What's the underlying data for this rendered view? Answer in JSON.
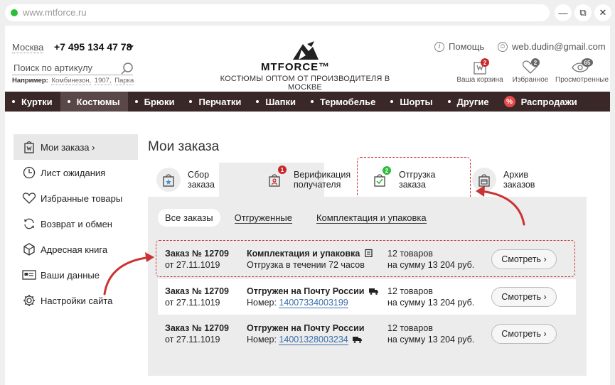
{
  "browser": {
    "url": "www.mtforce.ru",
    "buttons": {
      "minimize": "—",
      "restore": "⧉",
      "close": "✕"
    }
  },
  "header": {
    "city": "Москва",
    "phone": "+7 495 134 47 78",
    "search_placeholder": "Поиск по артикулу",
    "example_label": "Например:",
    "example_items": [
      "Комбинезон,",
      "1907,",
      "Парка"
    ],
    "logo_text": "MTFORCE™",
    "tagline": "КОСТЮМЫ ОПТОМ ОТ ПРОИЗВОДИТЕЛЯ В МОСКВЕ",
    "help": "Помощь",
    "user_email": "web.dudin@gmail.com",
    "cart": {
      "label": "Ваша корзина",
      "count": "2"
    },
    "favorites": {
      "label": "Избранное",
      "count": "2"
    },
    "viewed": {
      "label": "Просмотренные",
      "count": "65"
    }
  },
  "nav": {
    "items": [
      "Куртки",
      "Костюмы",
      "Брюки",
      "Перчатки",
      "Шапки",
      "Термобелье",
      "Шорты",
      "Другие"
    ],
    "sale": "Распродажи"
  },
  "sidebar": {
    "items": [
      "Мои заказа ›",
      "Лист ожидания",
      "Избранные товары",
      "Возврат и обмен",
      "Адресная книга",
      "Ваши данные",
      "Настройки сайта"
    ]
  },
  "main": {
    "title": "Мои заказа",
    "steps": [
      {
        "line1": "Сбор",
        "line2": "заказа",
        "badge": ""
      },
      {
        "line1": "Верификация",
        "line2": "получателя",
        "badge": "1"
      },
      {
        "line1": "Отгрузка",
        "line2": "заказа",
        "badge": "2"
      },
      {
        "line1": "Архив",
        "line2": "заказов",
        "badge": ""
      }
    ],
    "filters": [
      "Все заказы",
      "Отгруженные",
      "Комплектация и упаковка"
    ],
    "orders": [
      {
        "number": "Заказ № 12709",
        "date": "от 27.11.1019",
        "status": "Комплектация и упаковка",
        "detail": "Отгрузка в течении 72 часов",
        "track": "",
        "qty": "12 товаров",
        "sum": "на сумму 13 204 руб.",
        "button": "Смотреть ›"
      },
      {
        "number": "Заказ № 12709",
        "date": "от 27.11.1019",
        "status": "Отгружен на Почту России",
        "detail": "Номер:",
        "track": "14007334003199",
        "qty": "12 товаров",
        "sum": "на сумму 13 204 руб.",
        "button": "Смотреть ›"
      },
      {
        "number": "Заказ № 12709",
        "date": "от 27.11.1019",
        "status": "Отгружен на Почту России",
        "detail": "Номер:",
        "track": "14001328003234",
        "qty": "12 товаров",
        "sum": "на сумму 13 204 руб.",
        "button": "Смотреть ›"
      }
    ]
  },
  "colors": {
    "nav_bg": "#3a2828",
    "accent_red": "#c33",
    "badge_green": "#2dbd3a",
    "badge_red": "#c7292b",
    "link": "#3a6ea8"
  }
}
